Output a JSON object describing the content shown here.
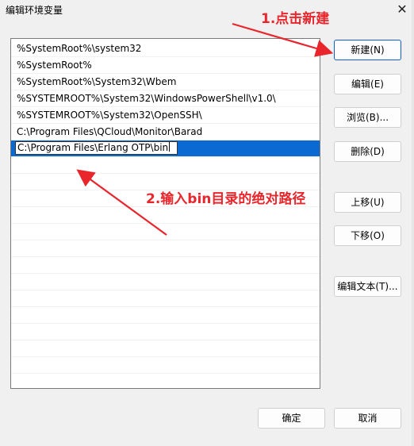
{
  "window": {
    "title": "编辑环境变量",
    "close_glyph": "✕"
  },
  "list": {
    "items": [
      "%SystemRoot%\\system32",
      "%SystemRoot%",
      "%SystemRoot%\\System32\\Wbem",
      "%SYSTEMROOT%\\System32\\WindowsPowerShell\\v1.0\\",
      "%SYSTEMROOT%\\System32\\OpenSSH\\",
      "C:\\Program Files\\QCloud\\Monitor\\Barad"
    ],
    "editing_value": "C:\\Program Files\\Erlang OTP\\bin"
  },
  "buttons": {
    "new": "新建(N)",
    "edit": "编辑(E)",
    "browse": "浏览(B)...",
    "delete": "删除(D)",
    "move_up": "上移(U)",
    "move_down": "下移(O)",
    "edit_text": "编辑文本(T)...",
    "ok": "确定",
    "cancel": "取消"
  },
  "annotations": {
    "step1": "1.点击新建",
    "step2": "2.输入bin目录的绝对路径",
    "color": "#e8262c"
  }
}
